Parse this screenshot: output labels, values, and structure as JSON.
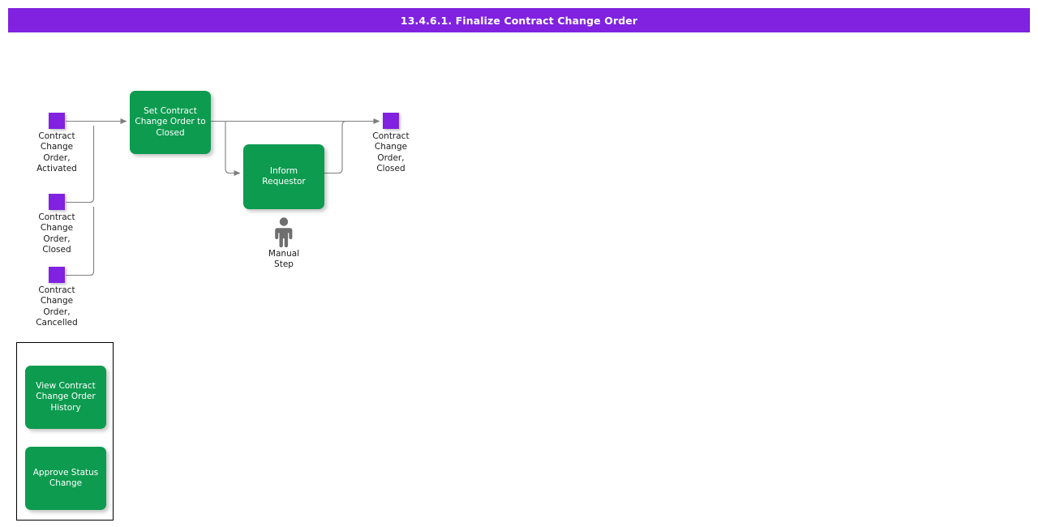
{
  "title": {
    "text": "13.4.6.1. Finalize Contract Change Order",
    "bar_color": "#8022e0",
    "text_color": "#ffffff"
  },
  "colors": {
    "event_purple": "#8022e0",
    "activity_green": "#0d9b4f",
    "connector_gray": "#7f7f7f",
    "manual_step_gray": "#6e6e6e",
    "legend_border": "#000000"
  },
  "events": {
    "start_activated": {
      "label": "Contract\nChange\nOrder,\nActivated",
      "icon": "event-square"
    },
    "start_closed": {
      "label": "Contract\nChange\nOrder,\nClosed",
      "icon": "event-square"
    },
    "start_cancelled": {
      "label": "Contract\nChange\nOrder,\nCancelled",
      "icon": "event-square"
    },
    "end_closed": {
      "label": "Contract\nChange\nOrder,\nClosed",
      "icon": "event-square"
    }
  },
  "activities": {
    "set_closed": {
      "label": "Set Contract\nChange Order to\nClosed"
    },
    "inform_requestor": {
      "label": "Inform\nRequestor"
    }
  },
  "manual_step": {
    "label": "Manual\nStep",
    "icon": "person-icon"
  },
  "legend": {
    "items": [
      {
        "label": "View Contract\nChange Order\nHistory"
      },
      {
        "label": "Approve Status\nChange"
      }
    ]
  }
}
